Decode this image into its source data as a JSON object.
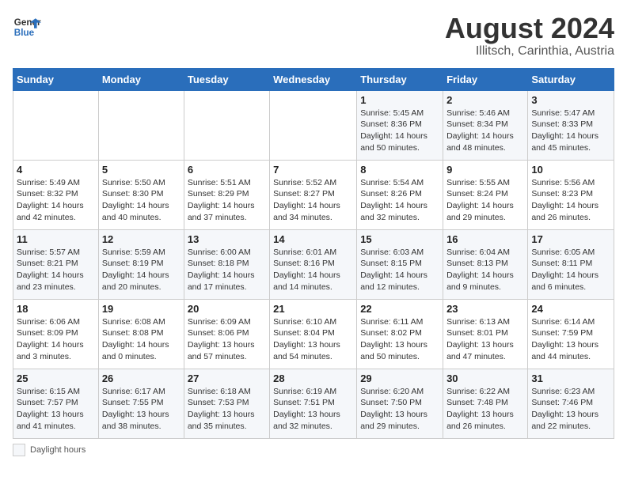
{
  "header": {
    "logo_line1": "General",
    "logo_line2": "Blue",
    "month": "August 2024",
    "location": "Illitsch, Carinthia, Austria"
  },
  "columns": [
    "Sunday",
    "Monday",
    "Tuesday",
    "Wednesday",
    "Thursday",
    "Friday",
    "Saturday"
  ],
  "weeks": [
    [
      {
        "day": "",
        "info": ""
      },
      {
        "day": "",
        "info": ""
      },
      {
        "day": "",
        "info": ""
      },
      {
        "day": "",
        "info": ""
      },
      {
        "day": "1",
        "info": "Sunrise: 5:45 AM\nSunset: 8:36 PM\nDaylight: 14 hours\nand 50 minutes."
      },
      {
        "day": "2",
        "info": "Sunrise: 5:46 AM\nSunset: 8:34 PM\nDaylight: 14 hours\nand 48 minutes."
      },
      {
        "day": "3",
        "info": "Sunrise: 5:47 AM\nSunset: 8:33 PM\nDaylight: 14 hours\nand 45 minutes."
      }
    ],
    [
      {
        "day": "4",
        "info": "Sunrise: 5:49 AM\nSunset: 8:32 PM\nDaylight: 14 hours\nand 42 minutes."
      },
      {
        "day": "5",
        "info": "Sunrise: 5:50 AM\nSunset: 8:30 PM\nDaylight: 14 hours\nand 40 minutes."
      },
      {
        "day": "6",
        "info": "Sunrise: 5:51 AM\nSunset: 8:29 PM\nDaylight: 14 hours\nand 37 minutes."
      },
      {
        "day": "7",
        "info": "Sunrise: 5:52 AM\nSunset: 8:27 PM\nDaylight: 14 hours\nand 34 minutes."
      },
      {
        "day": "8",
        "info": "Sunrise: 5:54 AM\nSunset: 8:26 PM\nDaylight: 14 hours\nand 32 minutes."
      },
      {
        "day": "9",
        "info": "Sunrise: 5:55 AM\nSunset: 8:24 PM\nDaylight: 14 hours\nand 29 minutes."
      },
      {
        "day": "10",
        "info": "Sunrise: 5:56 AM\nSunset: 8:23 PM\nDaylight: 14 hours\nand 26 minutes."
      }
    ],
    [
      {
        "day": "11",
        "info": "Sunrise: 5:57 AM\nSunset: 8:21 PM\nDaylight: 14 hours\nand 23 minutes."
      },
      {
        "day": "12",
        "info": "Sunrise: 5:59 AM\nSunset: 8:19 PM\nDaylight: 14 hours\nand 20 minutes."
      },
      {
        "day": "13",
        "info": "Sunrise: 6:00 AM\nSunset: 8:18 PM\nDaylight: 14 hours\nand 17 minutes."
      },
      {
        "day": "14",
        "info": "Sunrise: 6:01 AM\nSunset: 8:16 PM\nDaylight: 14 hours\nand 14 minutes."
      },
      {
        "day": "15",
        "info": "Sunrise: 6:03 AM\nSunset: 8:15 PM\nDaylight: 14 hours\nand 12 minutes."
      },
      {
        "day": "16",
        "info": "Sunrise: 6:04 AM\nSunset: 8:13 PM\nDaylight: 14 hours\nand 9 minutes."
      },
      {
        "day": "17",
        "info": "Sunrise: 6:05 AM\nSunset: 8:11 PM\nDaylight: 14 hours\nand 6 minutes."
      }
    ],
    [
      {
        "day": "18",
        "info": "Sunrise: 6:06 AM\nSunset: 8:09 PM\nDaylight: 14 hours\nand 3 minutes."
      },
      {
        "day": "19",
        "info": "Sunrise: 6:08 AM\nSunset: 8:08 PM\nDaylight: 14 hours\nand 0 minutes."
      },
      {
        "day": "20",
        "info": "Sunrise: 6:09 AM\nSunset: 8:06 PM\nDaylight: 13 hours\nand 57 minutes."
      },
      {
        "day": "21",
        "info": "Sunrise: 6:10 AM\nSunset: 8:04 PM\nDaylight: 13 hours\nand 54 minutes."
      },
      {
        "day": "22",
        "info": "Sunrise: 6:11 AM\nSunset: 8:02 PM\nDaylight: 13 hours\nand 50 minutes."
      },
      {
        "day": "23",
        "info": "Sunrise: 6:13 AM\nSunset: 8:01 PM\nDaylight: 13 hours\nand 47 minutes."
      },
      {
        "day": "24",
        "info": "Sunrise: 6:14 AM\nSunset: 7:59 PM\nDaylight: 13 hours\nand 44 minutes."
      }
    ],
    [
      {
        "day": "25",
        "info": "Sunrise: 6:15 AM\nSunset: 7:57 PM\nDaylight: 13 hours\nand 41 minutes."
      },
      {
        "day": "26",
        "info": "Sunrise: 6:17 AM\nSunset: 7:55 PM\nDaylight: 13 hours\nand 38 minutes."
      },
      {
        "day": "27",
        "info": "Sunrise: 6:18 AM\nSunset: 7:53 PM\nDaylight: 13 hours\nand 35 minutes."
      },
      {
        "day": "28",
        "info": "Sunrise: 6:19 AM\nSunset: 7:51 PM\nDaylight: 13 hours\nand 32 minutes."
      },
      {
        "day": "29",
        "info": "Sunrise: 6:20 AM\nSunset: 7:50 PM\nDaylight: 13 hours\nand 29 minutes."
      },
      {
        "day": "30",
        "info": "Sunrise: 6:22 AM\nSunset: 7:48 PM\nDaylight: 13 hours\nand 26 minutes."
      },
      {
        "day": "31",
        "info": "Sunrise: 6:23 AM\nSunset: 7:46 PM\nDaylight: 13 hours\nand 22 minutes."
      }
    ]
  ],
  "footer": {
    "legend": "Daylight hours"
  }
}
